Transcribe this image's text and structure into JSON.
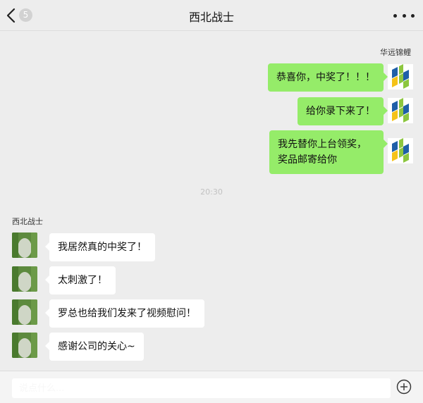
{
  "header": {
    "title": "西北战士",
    "unread_badge": "5"
  },
  "right_sender_name": "华远锦鲤",
  "left_sender_name": "西北战士",
  "timestamp": "20:30",
  "messages_right": [
    "恭喜你，中奖了！！！",
    "给你录下来了！",
    "我先替你上台领奖，奖品邮寄给你"
  ],
  "messages_right_lines": [
    "我先替你上台领奖，",
    "奖品邮寄给你"
  ],
  "messages_left": [
    "我居然真的中奖了！",
    "太刺激了！",
    "罗总也给我们发来了视频慰问！",
    "感谢公司的关心~"
  ],
  "input": {
    "value": "",
    "placeholder": "说点什么..."
  },
  "colors": {
    "bubble_right": "#95ec69",
    "bubble_left": "#ffffff",
    "background": "#ededed",
    "logo_green": "#8cc63f",
    "logo_blue": "#1f5fa8",
    "logo_yellow": "#f5c218"
  },
  "icons": {
    "back": "chevron-left-icon",
    "more": "more-dots-icon",
    "add": "plus-circle-icon"
  }
}
